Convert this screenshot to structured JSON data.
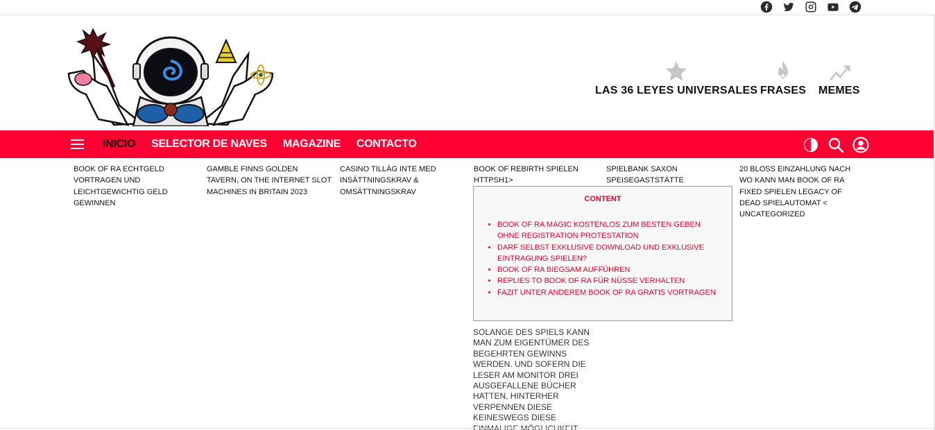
{
  "social": [
    "facebook-icon",
    "twitter-icon",
    "instagram-icon",
    "youtube-icon",
    "telegram-icon"
  ],
  "featured": [
    {
      "label": "LAS 36 LEYES UNIVERSALES",
      "icon": "star-icon"
    },
    {
      "label": "FRASES",
      "icon": "fire-icon"
    },
    {
      "label": "MEMES",
      "icon": "trending-arrow-icon"
    }
  ],
  "nav": {
    "items": [
      "INICIO",
      "SELECTOR DE NAVES",
      "MAGAZINE",
      "CONTACTO"
    ],
    "active": "INICIO",
    "accent": "#ff0033"
  },
  "posts": [
    "Book Of Ra Echtgeld Vortragen und Leichtgewichtig Geld Gewinnen",
    "Gamble Finns Golden Tavern, on the internet slot machines in britain 2023",
    "Casino tilläg inte med insättningskrav & omsättningskrav",
    "Book of rebirth spielen httpsh1>",
    "Spielbank Saxon Speisegaststätte",
    "20 Bloß Einzahlung Nach wo kann man book of ra fixed spielen Legacy Of Dead Spielautomat < Uncategorized"
  ],
  "toc": {
    "title": "Content",
    "items": [
      "Book Of Ra Magic Kostenlos zum besten geben Ohne Registration Protestation",
      "Darf selbst exklusive Download und exklusive Eintragung spielen?",
      "Book Of Ra biegsam aufführen",
      "Replies to Book of Ra für Nüsse Verhalten",
      "Fazit unter anderem Book of Ra gratis vortragen"
    ]
  },
  "paragraph": "Solange des Spiels kann man zum Eigentümer des begehrten Gewinns werden. Und sofern die Leser am Monitor drei ausgefallene Bücher hatten, hinterher verpennen diese keineswegs diese einmalige Möglichkeit"
}
